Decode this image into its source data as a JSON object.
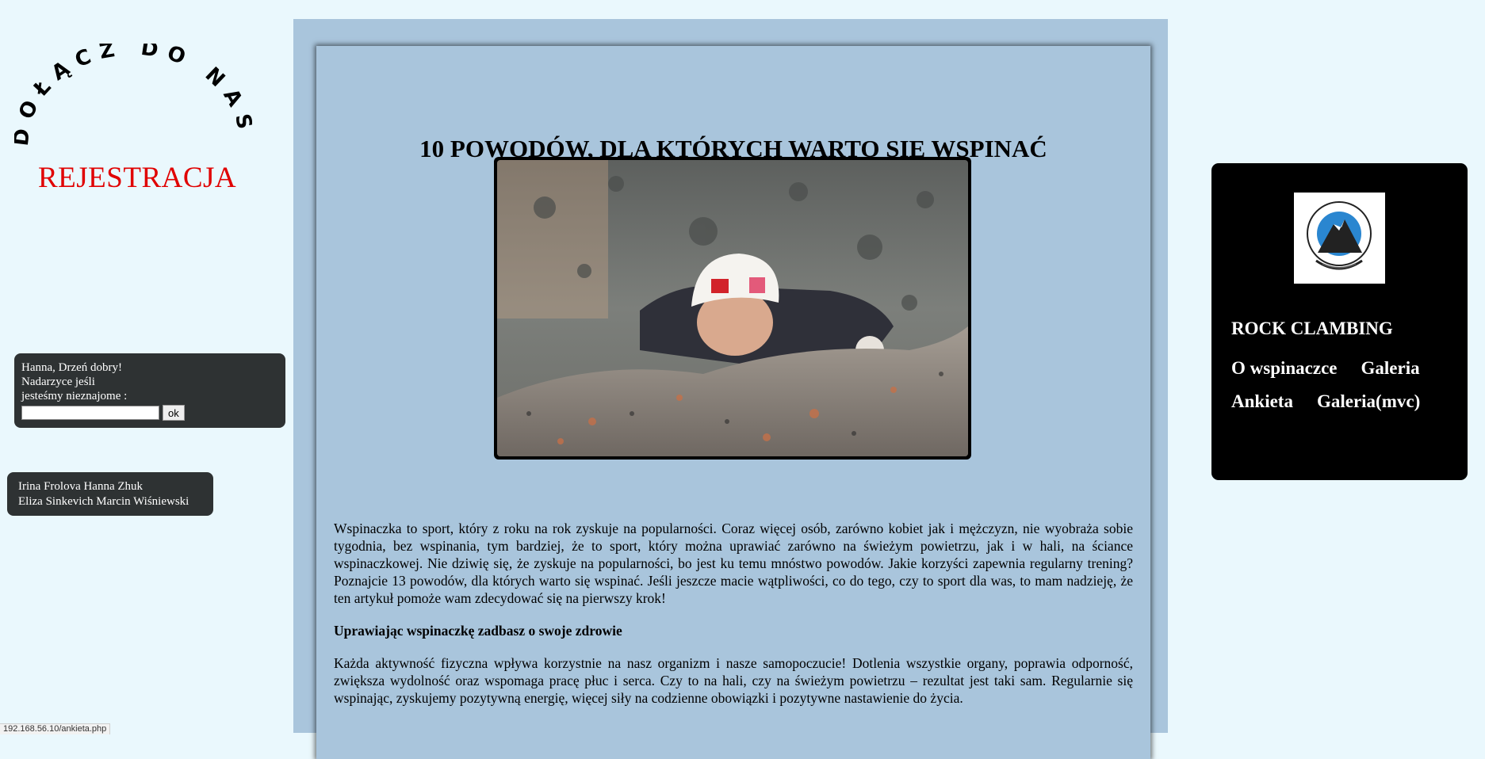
{
  "join": {
    "arc_text": "DOŁĄCZ DO NAS!",
    "register_label": "REJESTRACJA"
  },
  "greeting": {
    "line1": "Hanna, Drzeń dobry!",
    "line2": "Nadarzyce jeśli",
    "line3": "jesteśmy nieznajome :",
    "input_value": "",
    "ok_label": "ok"
  },
  "authors": {
    "line1": "Irina Frolova Hanna Zhuk",
    "line2": "Eliza Sinkevich Marcin Wiśniewski"
  },
  "article": {
    "title": "10 POWODÓW, DLA KTÓRYCH WARTO SIĘ WSPINAĆ",
    "intro": "Wspinaczka to sport, który z roku na rok zyskuje na popularności. Coraz więcej osób, zarówno kobiet jak i mężczyzn, nie wyobraża sobie tygodnia, bez wspinania, tym bardziej, że to sport, który można uprawiać zarówno na świeżym powietrzu, jak i w hali, na ściance wspinaczkowej. Nie dziwię się, że zyskuje na popularności, bo jest ku temu mnóstwo powodów. Jakie korzyści zapewnia regularny trening? Poznajcie 13 powodów, dla których warto się wspinać. Jeśli jeszcze macie wątpliwości, co do tego, czy to sport dla was, to mam nadzieję, że ten artykuł pomoże wam zdecydować się na pierwszy krok!",
    "subhead": "Uprawiając wspinaczkę zadbasz o swoje zdrowie",
    "paragraph2": "Każda aktywność fizyczna wpływa korzystnie na nasz organizm i nasze samopoczucie! Dotlenia wszystkie organy, poprawia odporność, zwiększa wydolność oraz wspomaga pracę płuc i serca. Czy to na hali, czy na świeżym powietrzu – rezultat jest taki sam. Regularnie się wspinając, zyskujemy pozytywną energię, więcej siły na codzienne obowiązki i pozytywne nastawienie do życia."
  },
  "sidebar_right": {
    "site_name": "ROCK CLAMBING",
    "nav": [
      "O wspinaczce",
      "Galeria",
      "Ankieta",
      "Galeria(mvc)"
    ]
  },
  "status_bar": {
    "url": "192.168.56.10/ankieta.php"
  },
  "colors": {
    "page_bg": "#eaf8fd",
    "panel_bg": "#a9c5dc",
    "register_red": "#e00000",
    "dark_box": "#2e3233",
    "nav_box": "#000000"
  }
}
